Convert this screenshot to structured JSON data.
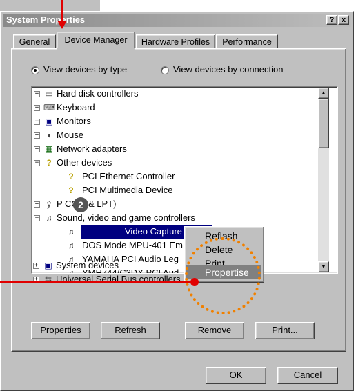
{
  "window": {
    "title": "System Properties",
    "help_button": "?",
    "close_button": "x"
  },
  "tabs": [
    {
      "label": "General",
      "active": false
    },
    {
      "label": "Device Manager",
      "active": true
    },
    {
      "label": "Hardware Profiles",
      "active": false
    },
    {
      "label": "Performance",
      "active": false
    }
  ],
  "view_options": {
    "by_type": "View devices by type",
    "by_connection": "View devices by connection",
    "selected": "by_type"
  },
  "tree": {
    "items": [
      {
        "label": "Hard disk controllers",
        "icon": "disk-controller-icon",
        "expanded": false
      },
      {
        "label": "Keyboard",
        "icon": "keyboard-icon",
        "expanded": false
      },
      {
        "label": "Monitors",
        "icon": "monitor-icon",
        "expanded": false
      },
      {
        "label": "Mouse",
        "icon": "mouse-icon",
        "expanded": false
      },
      {
        "label": "Network adapters",
        "icon": "network-adapter-icon",
        "expanded": false
      },
      {
        "label": "Other devices",
        "icon": "question-icon",
        "expanded": true
      },
      {
        "label": "PCI Ethernet Controller",
        "icon": "question-icon",
        "child": true
      },
      {
        "label": "PCI Multimedia Device",
        "icon": "question-icon",
        "child": true
      },
      {
        "label": "P COM & LPT)",
        "icon": "port-icon",
        "expanded": false
      },
      {
        "label": "Sound, video and game controllers",
        "icon": "sound-card-icon",
        "expanded": true
      },
      {
        "label": "Video Capture D",
        "icon": "sound-card-icon",
        "child": true,
        "selected": true
      },
      {
        "label": "DOS Mode MPU-401 Em",
        "icon": "sound-card-icon",
        "child": true
      },
      {
        "label": "YAMAHA PCI Audio Leg",
        "icon": "sound-card-icon",
        "child": true
      },
      {
        "label": "YMH744/C3DX PCI Aud",
        "icon": "sound-card-icon",
        "child": true
      },
      {
        "label": "System devices",
        "icon": "system-device-icon",
        "expanded": false
      },
      {
        "label": "Universal Serial Bus controllers",
        "icon": "usb-icon",
        "expanded": false
      }
    ]
  },
  "context_menu": {
    "items": [
      {
        "label": "Reflash"
      },
      {
        "label": "Delete"
      },
      {
        "label": "Print"
      },
      {
        "label": "Propertise",
        "highlighted": true
      }
    ]
  },
  "buttons": {
    "properties": "Properties",
    "refresh": "Refresh",
    "remove": "Remove",
    "print": "Print...",
    "ok": "OK",
    "cancel": "Cancel"
  },
  "annotations": {
    "step_badge": "2",
    "circle_color": "#f08000",
    "arrow_color": "#e00000"
  }
}
